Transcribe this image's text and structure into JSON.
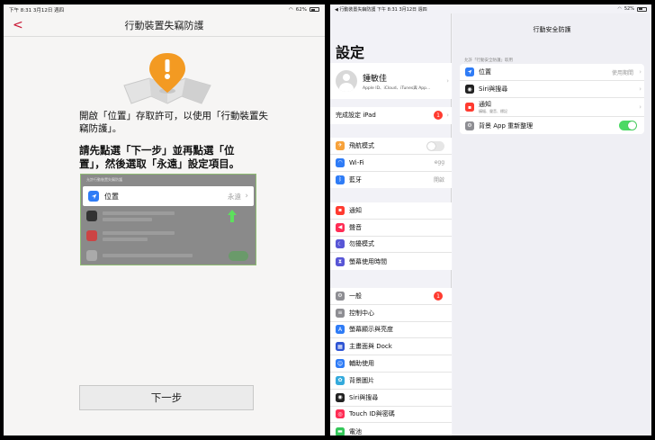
{
  "left": {
    "status": {
      "time": "下午 8:31",
      "date": "3月12日 週四",
      "battery": "62%"
    },
    "nav_title": "行動裝置失竊防護",
    "back_label": "<",
    "paragraph1": "開啟「位置」存取許可，以使用「行動裝置失竊防護」。",
    "paragraph2_pre": "請先點選「下一步」並再點選「位置」，然後選取「",
    "paragraph2_bold": "永遠",
    "paragraph2_post": "」設定項目。",
    "demo": {
      "header": "允許行動裝置失竊防護",
      "row_label": "位置",
      "row_value": "永遠"
    },
    "next_button": "下一步"
  },
  "right": {
    "status": {
      "back": "◀ 行動裝置失竊防護",
      "time": "下午 8:31",
      "date": "3月12日 週四",
      "battery": "52%"
    },
    "sidebar_title": "設定",
    "profile": {
      "name": "鍾敏佳",
      "sub": "Apple ID、iCloud、iTunes與 App..."
    },
    "setup": {
      "label": "完成設定 iPad",
      "badge": "1"
    },
    "group1": [
      {
        "label": "飛航模式",
        "value": "",
        "icon": "airplane-icon",
        "color": "#f7a23b"
      },
      {
        "label": "Wi-Fi",
        "value": "egg",
        "icon": "wifi-icon",
        "color": "#2f7cf6"
      },
      {
        "label": "藍牙",
        "value": "開啟",
        "icon": "bluetooth-icon",
        "color": "#2f7cf6"
      }
    ],
    "group2": [
      {
        "label": "通知",
        "icon": "notification-icon",
        "color": "#ff3b30"
      },
      {
        "label": "聲音",
        "icon": "sound-icon",
        "color": "#ff2d55"
      },
      {
        "label": "勿擾模式",
        "icon": "moon-icon",
        "color": "#5856d6"
      },
      {
        "label": "螢幕使用時間",
        "icon": "hourglass-icon",
        "color": "#5856d6"
      }
    ],
    "group3": [
      {
        "label": "一般",
        "badge": "1",
        "icon": "gear-icon",
        "color": "#8e8e93"
      },
      {
        "label": "控制中心",
        "icon": "control-center-icon",
        "color": "#8e8e93"
      },
      {
        "label": "螢幕顯示與亮度",
        "icon": "brightness-icon",
        "color": "#2f7cf6"
      },
      {
        "label": "主畫面與 Dock",
        "icon": "home-screen-icon",
        "color": "#2f55d4"
      },
      {
        "label": "輔助使用",
        "icon": "accessibility-icon",
        "color": "#2f7cf6"
      },
      {
        "label": "背景圖片",
        "icon": "wallpaper-icon",
        "color": "#34aadc"
      },
      {
        "label": "Siri與搜尋",
        "icon": "siri-icon",
        "color": "#222"
      },
      {
        "label": "Touch ID與密碼",
        "icon": "fingerprint-icon",
        "color": "#ff2d55"
      },
      {
        "label": "電池",
        "icon": "battery-icon",
        "color": "#34c759"
      }
    ],
    "detail": {
      "title": "行動安全防護",
      "header": "允許「行動安全防護」取用",
      "items": [
        {
          "label": "位置",
          "value": "使用期間",
          "icon": "location-icon",
          "color": "#2f7cf6"
        },
        {
          "label": "Siri與搜尋",
          "value": "",
          "icon": "siri-icon",
          "color": "#222"
        },
        {
          "label": "通知",
          "sub": "橫幅、聲音、標記",
          "value": "",
          "icon": "notification-icon",
          "color": "#ff3b30"
        },
        {
          "label": "背景 App 重新整理",
          "value": "",
          "icon": "gear-icon",
          "color": "#8e8e93",
          "toggle": true
        }
      ]
    }
  }
}
